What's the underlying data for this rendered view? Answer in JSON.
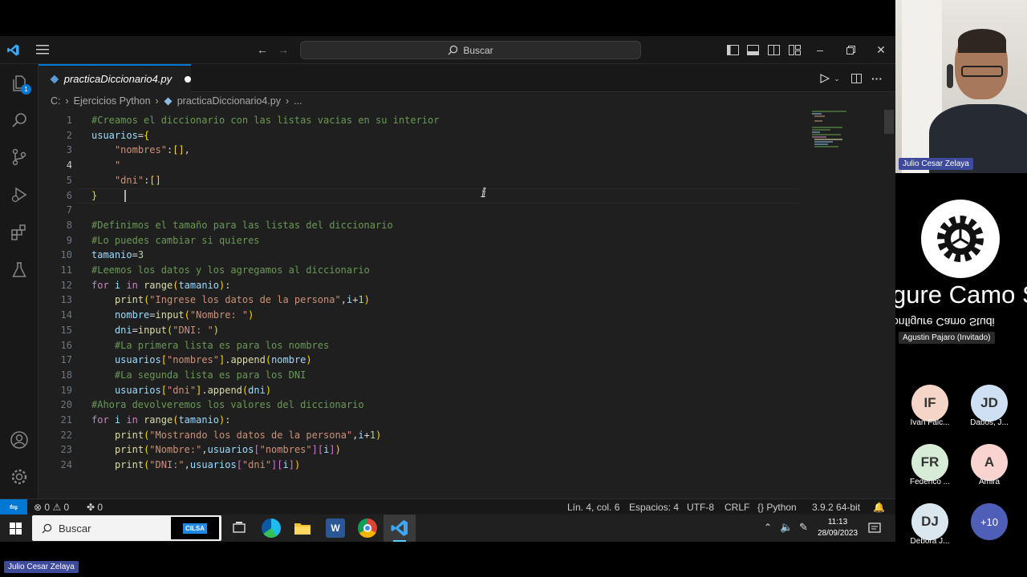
{
  "titlebar": {
    "search_label": "Buscar"
  },
  "tab": {
    "filename": "practicaDiccionario4.py"
  },
  "breadcrumb": {
    "drive": "C:",
    "folder": "Ejercicios Python",
    "file": "practicaDiccionario4.py",
    "more": "..."
  },
  "code_lines": [
    {
      "n": "1",
      "text": "#Creamos el diccionario con las listas vacias en su interior"
    },
    {
      "n": "2",
      "text": "usuarios={"
    },
    {
      "n": "3",
      "text": "    \"nombres\":[],"
    },
    {
      "n": "4",
      "text": "    \""
    },
    {
      "n": "5",
      "text": "    \"dni\":[]"
    },
    {
      "n": "6",
      "text": "}"
    },
    {
      "n": "7",
      "text": ""
    },
    {
      "n": "8",
      "text": "#Definimos el tamaño para las listas del diccionario"
    },
    {
      "n": "9",
      "text": "#Lo puedes cambiar si quieres"
    },
    {
      "n": "10",
      "text": "tamanio=3"
    },
    {
      "n": "11",
      "text": "#Leemos los datos y los agregamos al diccionario"
    },
    {
      "n": "12",
      "text": "for i in range(tamanio):"
    },
    {
      "n": "13",
      "text": "    print(\"Ingrese los datos de la persona\",i+1)"
    },
    {
      "n": "14",
      "text": "    nombre=input(\"Nombre: \")"
    },
    {
      "n": "15",
      "text": "    dni=input(\"DNI: \")"
    },
    {
      "n": "16",
      "text": "    #La primera lista es para los nombres"
    },
    {
      "n": "17",
      "text": "    usuarios[\"nombres\"].append(nombre)"
    },
    {
      "n": "18",
      "text": "    #La segunda lista es para los DNI"
    },
    {
      "n": "19",
      "text": "    usuarios[\"dni\"].append(dni)"
    },
    {
      "n": "20",
      "text": "#Ahora devolveremos los valores del diccionario"
    },
    {
      "n": "21",
      "text": "for i in range(tamanio):"
    },
    {
      "n": "22",
      "text": "    print(\"Mostrando los datos de la persona\",i+1)"
    },
    {
      "n": "23",
      "text": "    print(\"Nombre:\",usuarios[\"nombres\"][i])"
    },
    {
      "n": "24",
      "text": "    print(\"DNI:\",usuarios[\"dni\"][i])"
    }
  ],
  "statusbar": {
    "errors": "0",
    "warnings": "0",
    "ports": "0",
    "position": "Lín. 4, col. 6",
    "spaces": "Espacios: 4",
    "encoding": "UTF-8",
    "eol": "CRLF",
    "language": "Python",
    "interpreter": "3.9.2 64-bit"
  },
  "taskbar": {
    "search_label": "Buscar",
    "time": "11:13",
    "date": "28/09/2023",
    "cilsa_label": "CILSA"
  },
  "meeting": {
    "presenter_name": "Julio Cesar Zelaya",
    "share_title_large": "gure Camo S",
    "share_title_small": "onfigure Camo Studi",
    "guest_name": "Agustin Pajaro (Invitado)",
    "participants": [
      {
        "initials": "IF",
        "name": "Ivan Falc...",
        "color": "#f6d5c9"
      },
      {
        "initials": "JD",
        "name": "Dabos, J...",
        "color": "#cfe0f4"
      },
      {
        "initials": "FR",
        "name": "Federico ...",
        "color": "#d6ecd7"
      },
      {
        "initials": "A",
        "name": "Amira",
        "color": "#f8d3cf"
      },
      {
        "initials": "DJ",
        "name": "Debora J...",
        "color": "#dbe7ef"
      },
      {
        "initials": "+10",
        "name": "",
        "color": "#4f5fb8"
      }
    ],
    "self_name": "Julio Cesar Zelaya"
  },
  "colors": {
    "accent": "#0078d4",
    "editor_bg": "#1f1f1f"
  }
}
